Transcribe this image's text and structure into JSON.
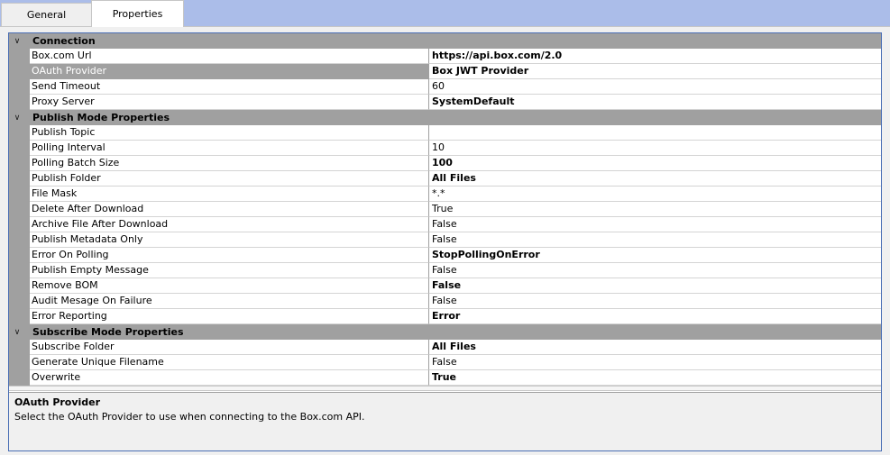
{
  "tabs": [
    {
      "label": "General",
      "active": false
    },
    {
      "label": "Properties",
      "active": true
    }
  ],
  "grid": {
    "categories": [
      {
        "label": "Connection",
        "expanded": true,
        "props": [
          {
            "name": "Box.com Url",
            "value": "https://api.box.com/2.0",
            "bold": true
          },
          {
            "name": "OAuth Provider",
            "value": "Box JWT Provider",
            "bold": true,
            "selected": true
          },
          {
            "name": "Send Timeout",
            "value": "60",
            "bold": false
          },
          {
            "name": "Proxy Server",
            "value": "SystemDefault",
            "bold": true
          }
        ]
      },
      {
        "label": "Publish Mode Properties",
        "expanded": true,
        "props": [
          {
            "name": "Publish Topic",
            "value": "",
            "bold": false
          },
          {
            "name": "Polling Interval",
            "value": "10",
            "bold": false
          },
          {
            "name": "Polling Batch Size",
            "value": "100",
            "bold": true
          },
          {
            "name": "Publish Folder",
            "value": "All Files",
            "bold": true
          },
          {
            "name": "File Mask",
            "value": "*.*",
            "bold": false
          },
          {
            "name": "Delete After Download",
            "value": "True",
            "bold": false
          },
          {
            "name": "Archive File After Download",
            "value": "False",
            "bold": false
          },
          {
            "name": "Publish Metadata Only",
            "value": "False",
            "bold": false
          },
          {
            "name": "Error On Polling",
            "value": "StopPollingOnError",
            "bold": true
          },
          {
            "name": "Publish Empty Message",
            "value": "False",
            "bold": false
          },
          {
            "name": "Remove BOM",
            "value": "False",
            "bold": true
          },
          {
            "name": "Audit Mesage On Failure",
            "value": "False",
            "bold": false
          },
          {
            "name": "Error Reporting",
            "value": "Error",
            "bold": true
          }
        ]
      },
      {
        "label": "Subscribe Mode Properties",
        "expanded": true,
        "props": [
          {
            "name": "Subscribe Folder",
            "value": "All Files",
            "bold": true
          },
          {
            "name": "Generate Unique Filename",
            "value": "False",
            "bold": false
          },
          {
            "name": "Overwrite",
            "value": "True",
            "bold": true
          }
        ]
      }
    ]
  },
  "description": {
    "title": "OAuth Provider",
    "text": "Select the OAuth Provider to use when connecting to the Box.com API."
  },
  "icons": {
    "collapse": "chevron-down-icon"
  },
  "colors": {
    "tabstrip": "#abbde9",
    "category": "#a0a0a0",
    "frame": "#4a6fb5"
  }
}
